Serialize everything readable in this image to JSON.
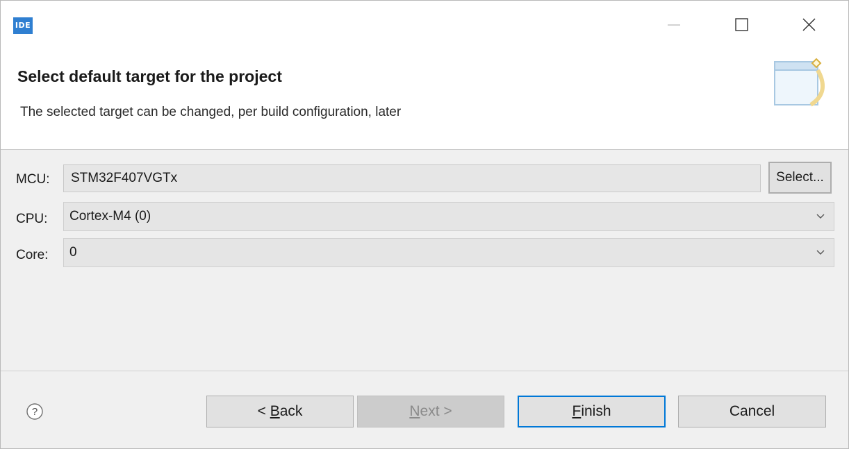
{
  "window": {
    "app_icon_label": "IDE",
    "controls": {
      "minimize_icon": "minimize-icon",
      "maximize_icon": "maximize-icon",
      "close_icon": "close-icon"
    }
  },
  "banner": {
    "title": "Select default target for the project",
    "description": "The selected target can be changed, per build configuration, later",
    "icon": "wizard-banner-icon"
  },
  "form": {
    "mcu_label": "MCU:",
    "mcu_value": "STM32F407VGTx",
    "select_button": "Select...",
    "cpu_label": "CPU:",
    "cpu_value": "Cortex-M4 (0)",
    "core_label": "Core:",
    "core_value": "0"
  },
  "footer": {
    "help_icon": "help-icon",
    "back_prefix": "< ",
    "back_mnemonic": "B",
    "back_rest": "ack",
    "next_mnemonic": "N",
    "next_rest": "ext >",
    "finish_mnemonic": "F",
    "finish_rest": "inish",
    "cancel_label": "Cancel",
    "next_enabled": false,
    "default_button": "finish"
  },
  "colors": {
    "accent": "#0078d7",
    "dialog_bg": "#f0f0f0",
    "banner_bg": "#ffffff",
    "app_icon_bg": "#2f7fd1"
  }
}
